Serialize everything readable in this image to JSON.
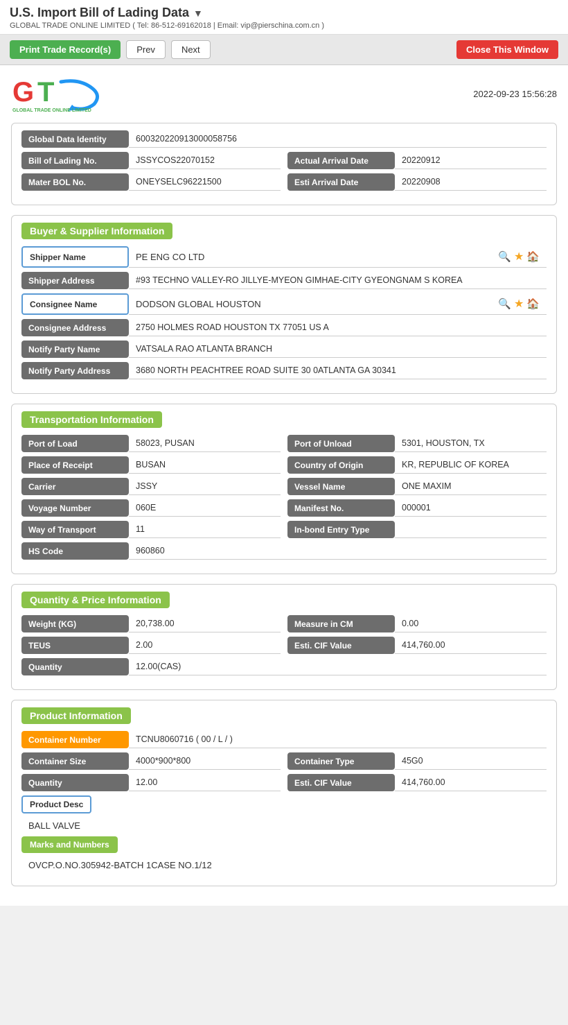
{
  "header": {
    "title": "U.S. Import Bill of Lading Data",
    "subtitle": "GLOBAL TRADE ONLINE LIMITED ( Tel: 86-512-69162018 | Email: vip@pierschina.com.cn )",
    "timestamp": "2022-09-23 15:56:28"
  },
  "toolbar": {
    "print_label": "Print Trade Record(s)",
    "prev_label": "Prev",
    "next_label": "Next",
    "close_label": "Close This Window"
  },
  "identity": {
    "global_data_identity_label": "Global Data Identity",
    "global_data_identity_value": "600320220913000058756",
    "bol_no_label": "Bill of Lading No.",
    "bol_no_value": "JSSYCOS22070152",
    "actual_arrival_label": "Actual Arrival Date",
    "actual_arrival_value": "20220912",
    "master_bol_label": "Mater BOL No.",
    "master_bol_value": "ONEYSELC96221500",
    "esti_arrival_label": "Esti Arrival Date",
    "esti_arrival_value": "20220908"
  },
  "buyer_supplier": {
    "section_title": "Buyer & Supplier Information",
    "shipper_name_label": "Shipper Name",
    "shipper_name_value": "PE ENG CO LTD",
    "shipper_address_label": "Shipper Address",
    "shipper_address_value": "#93 TECHNO VALLEY-RO JILLYE-MYEON GIMHAE-CITY GYEONGNAM S KOREA",
    "consignee_name_label": "Consignee Name",
    "consignee_name_value": "DODSON GLOBAL HOUSTON",
    "consignee_address_label": "Consignee Address",
    "consignee_address_value": "2750 HOLMES ROAD HOUSTON TX 77051 US A",
    "notify_party_name_label": "Notify Party Name",
    "notify_party_name_value": "VATSALA RAO ATLANTA BRANCH",
    "notify_party_address_label": "Notify Party Address",
    "notify_party_address_value": "3680 NORTH PEACHTREE ROAD SUITE 30 0ATLANTA GA 30341"
  },
  "transportation": {
    "section_title": "Transportation Information",
    "port_of_load_label": "Port of Load",
    "port_of_load_value": "58023, PUSAN",
    "port_of_unload_label": "Port of Unload",
    "port_of_unload_value": "5301, HOUSTON, TX",
    "place_of_receipt_label": "Place of Receipt",
    "place_of_receipt_value": "BUSAN",
    "country_of_origin_label": "Country of Origin",
    "country_of_origin_value": "KR, REPUBLIC OF KOREA",
    "carrier_label": "Carrier",
    "carrier_value": "JSSY",
    "vessel_name_label": "Vessel Name",
    "vessel_name_value": "ONE MAXIM",
    "voyage_number_label": "Voyage Number",
    "voyage_number_value": "060E",
    "manifest_no_label": "Manifest No.",
    "manifest_no_value": "000001",
    "way_of_transport_label": "Way of Transport",
    "way_of_transport_value": "11",
    "in_bond_entry_label": "In-bond Entry Type",
    "in_bond_entry_value": "",
    "hs_code_label": "HS Code",
    "hs_code_value": "960860"
  },
  "quantity_price": {
    "section_title": "Quantity & Price Information",
    "weight_label": "Weight (KG)",
    "weight_value": "20,738.00",
    "measure_label": "Measure in CM",
    "measure_value": "0.00",
    "teus_label": "TEUS",
    "teus_value": "2.00",
    "esti_cif_label": "Esti. CIF Value",
    "esti_cif_value": "414,760.00",
    "quantity_label": "Quantity",
    "quantity_value": "12.00(CAS)"
  },
  "product": {
    "section_title": "Product Information",
    "container_number_label": "Container Number",
    "container_number_value": "TCNU8060716 ( 00 / L / )",
    "container_size_label": "Container Size",
    "container_size_value": "4000*900*800",
    "container_type_label": "Container Type",
    "container_type_value": "45G0",
    "quantity_label": "Quantity",
    "quantity_value": "12.00",
    "esti_cif_label": "Esti. CIF Value",
    "esti_cif_value": "414,760.00",
    "product_desc_label": "Product Desc",
    "product_desc_value": "BALL VALVE",
    "marks_numbers_label": "Marks and Numbers",
    "marks_numbers_value": "OVCP.O.NO.305942-BATCH 1CASE NO.1/12"
  }
}
